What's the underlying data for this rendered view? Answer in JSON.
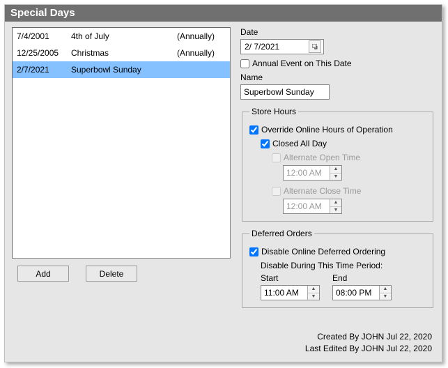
{
  "title": "Special Days",
  "list": {
    "rows": [
      {
        "date": "7/4/2001",
        "name": "4th of July",
        "ann": "(Annually)"
      },
      {
        "date": "12/25/2005",
        "name": "Christmas",
        "ann": "(Annually)"
      },
      {
        "date": "2/7/2021",
        "name": "Superbowl Sunday",
        "ann": ""
      }
    ]
  },
  "buttons": {
    "add": "Add",
    "delete": "Delete"
  },
  "date": {
    "label": "Date",
    "value": "2/  7/2021"
  },
  "annual": {
    "label": "Annual Event on This Date",
    "checked": false
  },
  "name": {
    "label": "Name",
    "value": "Superbowl Sunday"
  },
  "storeHours": {
    "legend": "Store Hours",
    "override": {
      "label": "Override Online Hours of Operation",
      "checked": true
    },
    "closedAllDay": {
      "label": "Closed All Day",
      "checked": true
    },
    "altOpen": {
      "label": "Alternate Open Time",
      "checked": false,
      "value": "12:00 AM"
    },
    "altClose": {
      "label": "Alternate Close Time",
      "checked": false,
      "value": "12:00 AM"
    }
  },
  "deferred": {
    "legend": "Deferred Orders",
    "disable": {
      "label": "Disable Online Deferred Ordering",
      "checked": true
    },
    "periodLabel": "Disable During This Time Period:",
    "start": {
      "label": "Start",
      "value": "11:00 AM"
    },
    "end": {
      "label": "End",
      "value": "08:00 PM"
    }
  },
  "footer": {
    "created": "Created By JOHN Jul 22, 2020",
    "edited": "Last Edited By JOHN Jul 22, 2020"
  }
}
